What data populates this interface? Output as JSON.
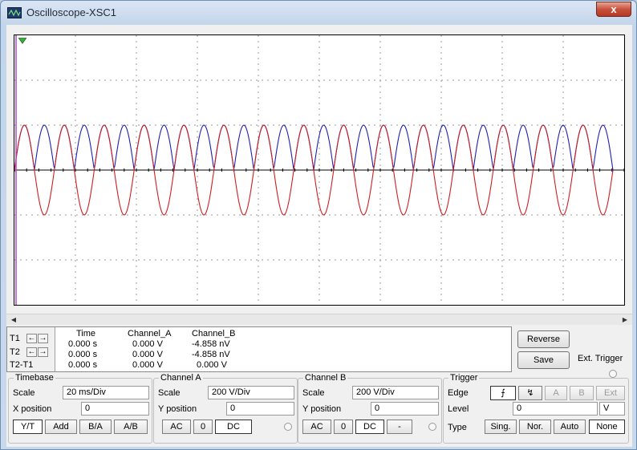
{
  "window": {
    "title": "Oscilloscope-XSC1",
    "close_glyph": "x"
  },
  "readout": {
    "rows": [
      {
        "label": "T1",
        "time": "0.000 s",
        "a": "0.000 V",
        "b": "-4.858 nV"
      },
      {
        "label": "T2",
        "time": "0.000 s",
        "a": "0.000 V",
        "b": "-4.858 nV"
      },
      {
        "label": "T2-T1",
        "time": "0.000 s",
        "a": "0.000 V",
        "b": "0.000 V"
      }
    ],
    "headers": {
      "time": "Time",
      "a": "Channel_A",
      "b": "Channel_B"
    },
    "arrow_left": "←",
    "arrow_right": "→"
  },
  "buttons": {
    "reverse": "Reverse",
    "save": "Save"
  },
  "ext_trigger": "Ext. Trigger",
  "timebase": {
    "title": "Timebase",
    "scale_label": "Scale",
    "scale_value": "20 ms/Div",
    "xpos_label": "X position",
    "xpos_value": "0",
    "modes": [
      "Y/T",
      "Add",
      "B/A",
      "A/B"
    ]
  },
  "channel_a": {
    "title": "Channel A",
    "scale_label": "Scale",
    "scale_value": "200  V/Div",
    "ypos_label": "Y position",
    "ypos_value": "0",
    "coupling": [
      "AC",
      "0",
      "DC"
    ]
  },
  "channel_b": {
    "title": "Channel B",
    "scale_label": "Scale",
    "scale_value": "200  V/Div",
    "ypos_label": "Y position",
    "ypos_value": "0",
    "coupling": [
      "AC",
      "0",
      "DC",
      "-"
    ]
  },
  "trigger": {
    "title": "Trigger",
    "edge_label": "Edge",
    "edge_rise": "⨍",
    "edge_fall": "↯",
    "sources": [
      "A",
      "B",
      "Ext"
    ],
    "level_label": "Level",
    "level_value": "0",
    "level_unit": "V",
    "type_label": "Type",
    "types": [
      "Sing.",
      "Nor.",
      "Auto",
      "None"
    ]
  },
  "trace": {
    "channel_a_color": "#cc1f1f",
    "channel_b_color": "#1f1fb4",
    "cursor_color": "#b044c8",
    "cycles": 15,
    "amplitude_div": 1
  }
}
